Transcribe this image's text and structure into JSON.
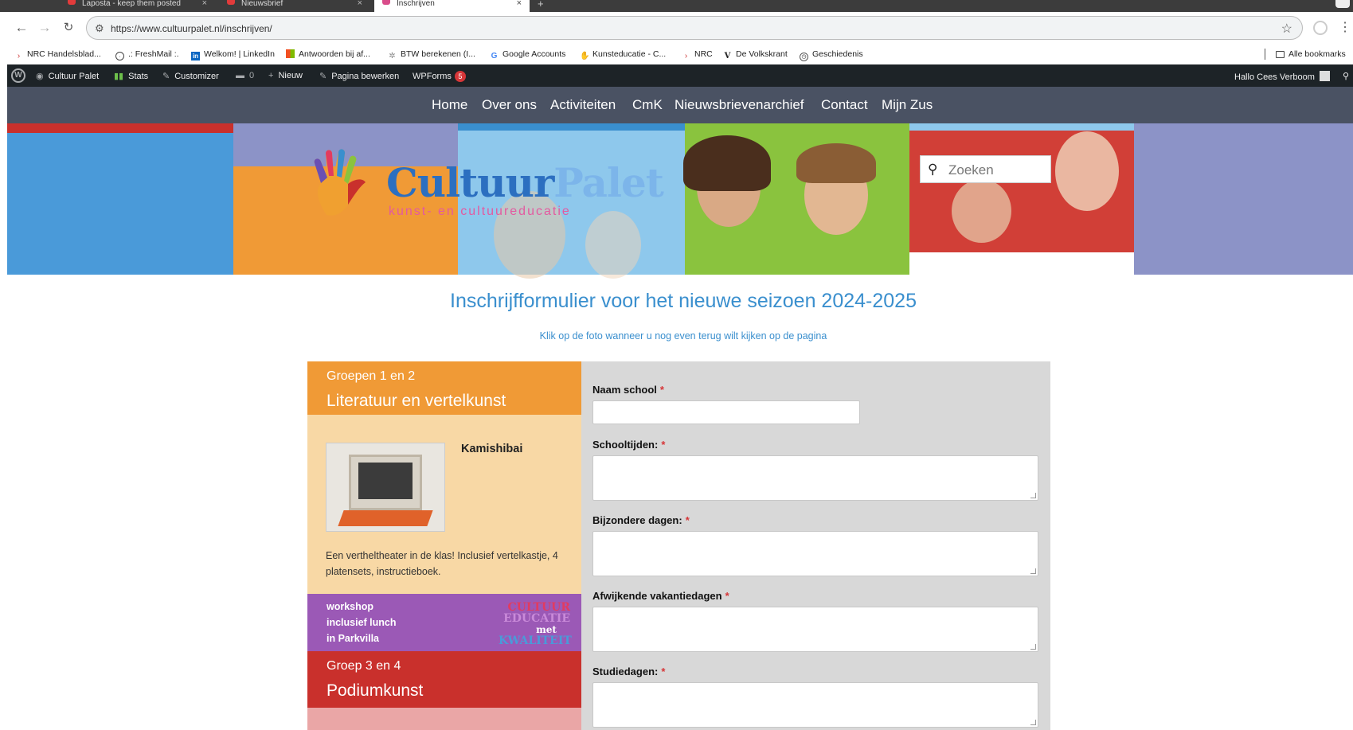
{
  "browser": {
    "tabs": [
      {
        "title": "Laposta - keep them posted"
      },
      {
        "title": "Nieuwsbrief"
      },
      {
        "title": "Inschrijven"
      }
    ],
    "url": "https://www.cultuurpalet.nl/inschrijven/",
    "bookmarks": [
      {
        "label": "NRC Handelsblad...",
        "icon": "chevron-icon"
      },
      {
        "label": ".: FreshMail :.",
        "icon": "globe-icon"
      },
      {
        "label": "Welkom! | LinkedIn",
        "icon": "linkedin-icon"
      },
      {
        "label": "Antwoorden bij af...",
        "icon": "microsoft-icon"
      },
      {
        "label": "BTW berekenen (I...",
        "icon": "btw-icon"
      },
      {
        "label": "Google Accounts",
        "icon": "google-icon"
      },
      {
        "label": "Kunsteducatie - C...",
        "icon": "kunsteducatie-icon"
      },
      {
        "label": "NRC",
        "icon": "chevron-icon"
      },
      {
        "label": "De Volkskrant",
        "icon": "volkskrant-icon"
      },
      {
        "label": "Geschiedenis",
        "icon": "history-icon"
      }
    ],
    "all_bookmarks": "Alle bookmarks"
  },
  "wpbar": {
    "site": "Cultuur Palet",
    "stats": "Stats",
    "customizer": "Customizer",
    "comments": "0",
    "new": "Nieuw",
    "edit_page": "Pagina bewerken",
    "wpforms": "WPForms",
    "wpforms_badge": "5",
    "greeting": "Hallo Cees Verboom"
  },
  "nav": {
    "items": [
      "Home",
      "Over ons",
      "Activiteiten",
      "CmK",
      "Nieuwsbrievenarchief",
      "Contact",
      "Mijn Zus"
    ]
  },
  "header": {
    "logo_main": "Cultuur",
    "logo_accent": "Palet",
    "logo_sub": "kunst- en cultuureducatie",
    "search_placeholder": "Zoeken"
  },
  "page": {
    "title": "Inschrijfformulier voor het nieuwe seizoen 2024-2025",
    "subtitle": "Klik op de foto wanneer u nog even terug wilt kijken op de pagina"
  },
  "left": {
    "group1_small": "Groepen 1 en 2",
    "group1_large": "Literatuur en vertelkunst",
    "activity_title": "Kamishibai",
    "activity_desc": "Een vertheltheater in de klas! Inclusief vertelkastje, 4 platensets, instructieboek.",
    "promo_lines": [
      "workshop",
      "inclusief lunch",
      "in Parkvilla"
    ],
    "promo_logo": [
      "CULTUUR",
      "EDUCATIE",
      "met",
      "KWALITEIT"
    ],
    "group2_small": "Groep 3 en 4",
    "group2_large": "Podiumkunst"
  },
  "form": {
    "fields": [
      {
        "label": "Naam school"
      },
      {
        "label": "Schooltijden:"
      },
      {
        "label": "Bijzondere dagen:"
      },
      {
        "label": "Afwijkende vakantiedagen"
      },
      {
        "label": "Studiedagen:"
      }
    ],
    "required_mark": "*"
  },
  "colors": {
    "accent_blue": "#3a8fce",
    "orange": "#f09a36",
    "purple": "#9b59b6",
    "red": "#c9302c",
    "green": "#8ac33e",
    "nav_bg": "#4a5263"
  }
}
